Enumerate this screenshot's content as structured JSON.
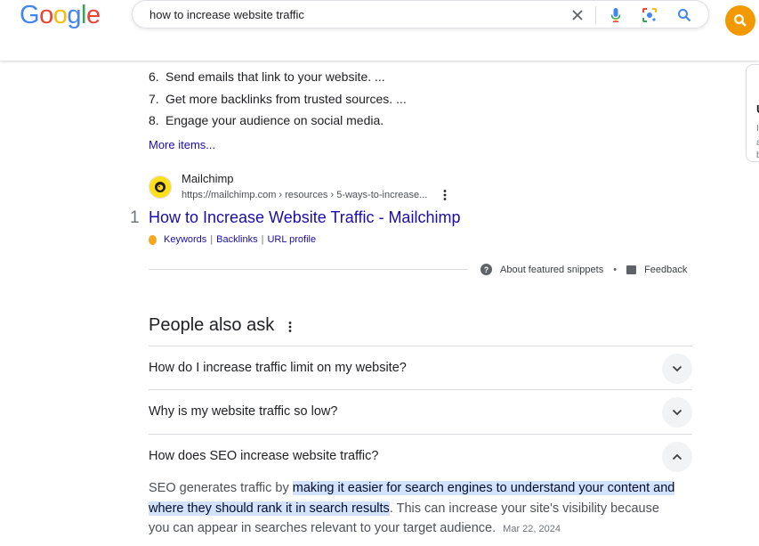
{
  "header": {
    "logo_letters": [
      "G",
      "o",
      "o",
      "g",
      "l",
      "e"
    ],
    "logo_colors": [
      "#4285f4",
      "#ea4335",
      "#fbbc05",
      "#4285f4",
      "#34a853",
      "#ea4335"
    ],
    "query": "how to increase website traffic"
  },
  "list": {
    "items": [
      {
        "num": "6.",
        "text": "Send emails that link to your website. ..."
      },
      {
        "num": "7.",
        "text": "Get more backlinks from trusted sources. ..."
      },
      {
        "num": "8.",
        "text": "Engage your audience on social media."
      }
    ],
    "more_items": "More items..."
  },
  "result": {
    "site_name": "Mailchimp",
    "url": "https://mailchimp.com › resources › 5-ways-to-increase...",
    "rank": "1",
    "title": "How to Increase Website Traffic - Mailchimp",
    "ext_links": [
      "Keywords",
      "Backlinks",
      "URL profile"
    ],
    "ext_separator": "|"
  },
  "snippet_footer": {
    "about": "About featured snippets",
    "dot": "•",
    "feedback": "Feedback"
  },
  "paa": {
    "title": "People also ask",
    "questions": [
      "How do I increase traffic limit on my website?",
      "Why is my website traffic so low?",
      "How does SEO increase website traffic?"
    ],
    "answer_pre": "SEO generates traffic by ",
    "answer_highlight": "making it easier for search engines to understand your content and where they should rank it in search results",
    "answer_post": ". This can increase your site's visibility because you can appear in searches relevant to your target audience.",
    "answer_date": "Mar 22, 2024"
  },
  "icons": {
    "clear": "close-icon",
    "voice": "microphone-icon",
    "lens": "lens-icon",
    "search": "search-icon",
    "avatar": "search-extension-icon",
    "kebab": "more-vert-icon",
    "chevron_down": "chevron-down-icon",
    "chevron_up": "chevron-up-icon"
  },
  "colors": {
    "link": "#1a0dab",
    "highlight": "#d3e3fd",
    "avatar_bg": "#f29900",
    "mailchimp_yellow": "#ffe01b"
  }
}
